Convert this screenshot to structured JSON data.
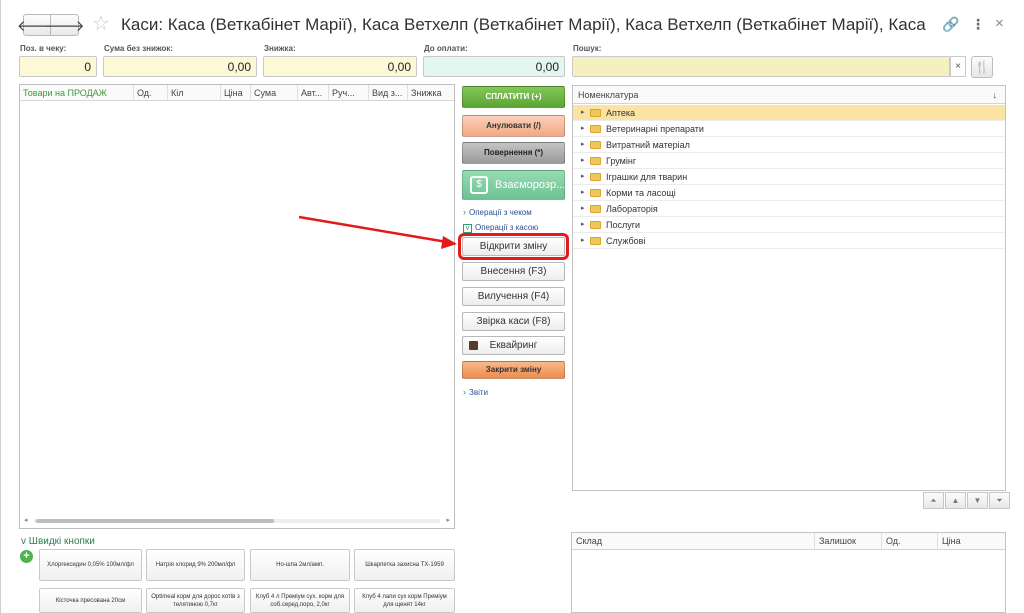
{
  "window": {
    "title": "Каси: Каса (Веткабінет Марії), Каса Ветхелп (Веткабінет Марії), Каса Ветхелп (Веткабінет Марії), Каса (Ветк...",
    "icons": {
      "back": "arrow-left-icon",
      "forward": "arrow-right-icon",
      "favorite": "star-icon",
      "link": "link-icon",
      "more": "more-vertical-icon",
      "close": "close-icon"
    },
    "back_glyph": "🡐",
    "forward_glyph": "🡒",
    "star_glyph": "☆",
    "link_glyph": "🔗",
    "more_glyph": "⋮",
    "close_glyph": "×"
  },
  "fields": {
    "positions": {
      "label": "Поз. в чеку:",
      "value": "0"
    },
    "sum_no_discount": {
      "label": "Сума без знижок:",
      "value": "0,00"
    },
    "discount": {
      "label": "Знижка:",
      "value": "0,00"
    },
    "to_pay": {
      "label": "До оплати:",
      "value": "0,00"
    },
    "search": {
      "label": "Пошук:",
      "value": "",
      "clear_glyph": "×"
    },
    "tool_glyph": "🍴"
  },
  "goods_table": {
    "columns": [
      "Товари на ПРОДАЖ",
      "Од.",
      "Кіл",
      "Ціна",
      "Сума",
      "Авт...",
      "Руч...",
      "Вид з...",
      "Знижка"
    ],
    "scroll_left": "◂",
    "scroll_right": "▸"
  },
  "actions": {
    "pay": "СПЛАТИТИ (+)",
    "cancel": "Анулювати (/)",
    "return": "Повернення (*)",
    "mutual": "Взаєморозр...",
    "mutual_icon_glyph": "$",
    "receipt_ops": "Операції з чеком",
    "cash_ops": "Операції з касою",
    "open_shift": "Відкрити зміну",
    "deposit": "Внесення (F3)",
    "withdraw": "Вилучення (F4)",
    "reconcile": "Звірка каси (F8)",
    "acquiring": "Еквайринг",
    "close_shift": "Закрити зміну",
    "reports": "Звіти",
    "chevron_glyph": "›",
    "box_glyph": "v"
  },
  "annotation": {
    "color": "#e31a1a"
  },
  "tree": {
    "header": "Номенклатура",
    "sort_glyph": "↓",
    "triangle_glyph": "▸",
    "items": [
      "Аптека",
      "Ветеринарні препарати",
      "Витратний матеріал",
      "Грумінг",
      "Іграшки для тварин",
      "Корми та ласощі",
      "Лабораторія",
      "Послуги",
      "Службові"
    ],
    "pager": [
      "⏶",
      "▲",
      "▼",
      "⏷"
    ]
  },
  "quick": {
    "title": "Швидкі кнопки",
    "chevron_glyph": "v",
    "add_glyph": "+",
    "buttons": [
      "Хлоргексидин 0,05% 100мл/фл",
      "Натрія хлорид 9% 200мл/фл",
      "Но-шпа 2мл/амп.",
      "Шкарпетка захисна ТХ-1959",
      "Кісточка пресована 20см",
      "Optimeal корм для дорос котів з телятиною 0,7кг",
      "Клуб 4 л Преміум сух. корм для соб.серед.поро, 2,0кг",
      "Клуб 4 лапи сух корм Преміум для щенят 14кг"
    ]
  },
  "stock_table": {
    "columns": [
      "Склад",
      "Залишок",
      "Од.",
      "Ціна"
    ]
  }
}
